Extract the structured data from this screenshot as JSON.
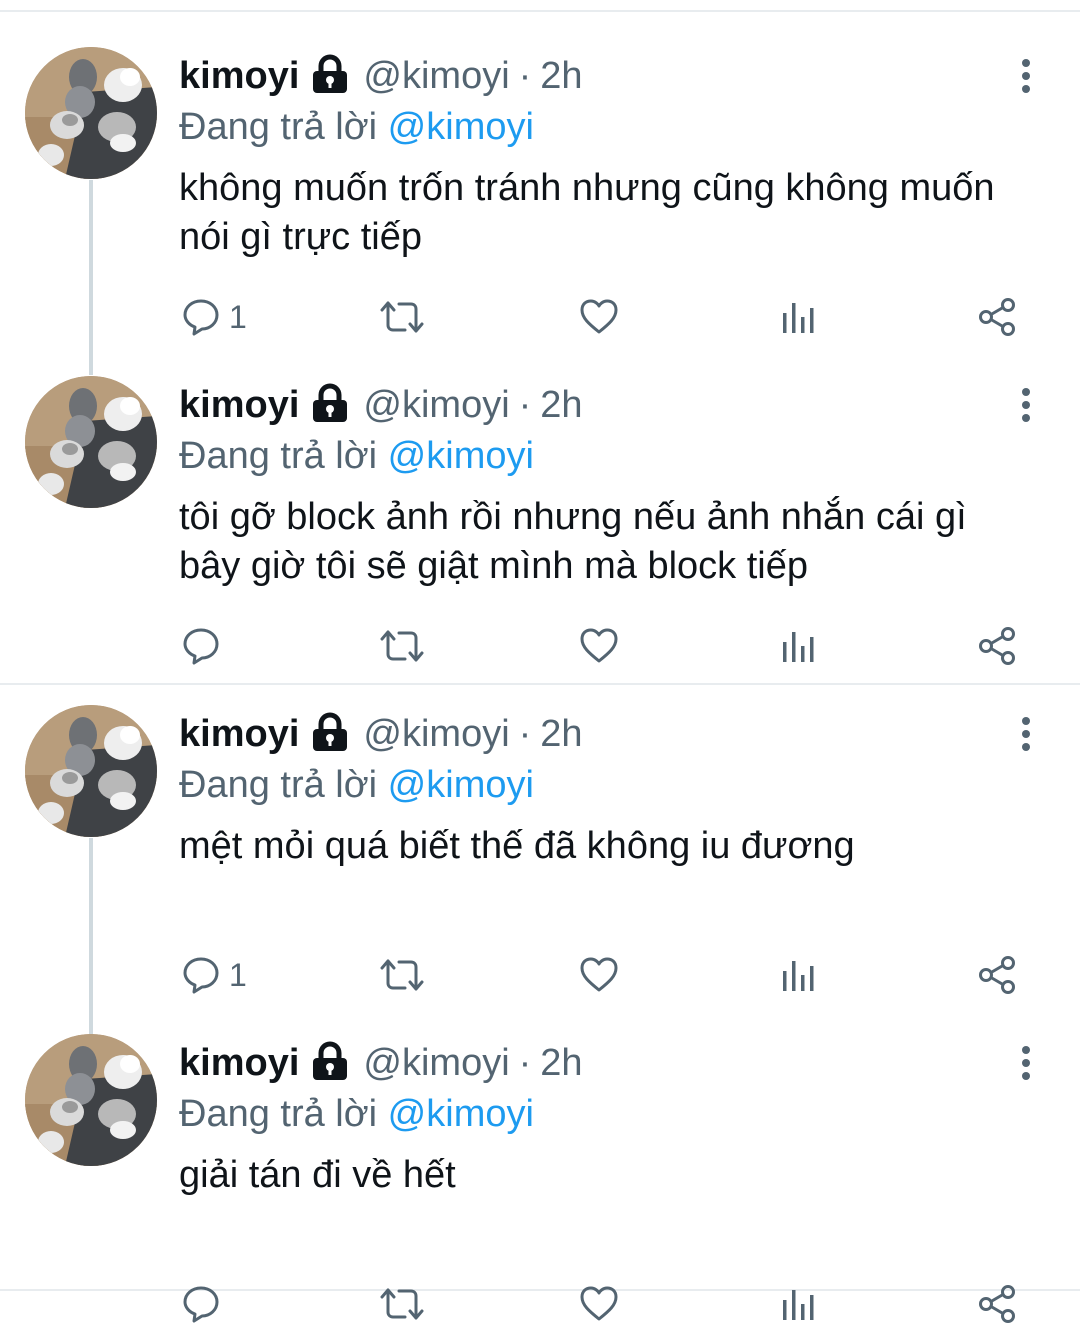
{
  "tweets": [
    {
      "name": "kimoyi",
      "handle": "@kimoyi",
      "dot": "·",
      "time": "2h",
      "reply_prefix": "Đang trả lời",
      "reply_mention": "@kimoyi",
      "text": "không muốn trốn tránh nhưng cũng không muốn nói gì trực tiếp",
      "reply_count": "1",
      "icons": [
        "lock-icon",
        "more-icon",
        "reply-icon",
        "retweet-icon",
        "like-icon",
        "analytics-icon",
        "share-icon"
      ]
    },
    {
      "name": "kimoyi",
      "handle": "@kimoyi",
      "dot": "·",
      "time": "2h",
      "reply_prefix": "Đang trả lời",
      "reply_mention": "@kimoyi",
      "text": "tôi gỡ block ảnh rồi nhưng nếu ảnh nhắn cái gì bây giờ tôi sẽ giật mình mà block tiếp",
      "reply_count": ""
    },
    {
      "name": "kimoyi",
      "handle": "@kimoyi",
      "dot": "·",
      "time": "2h",
      "reply_prefix": "Đang trả lời",
      "reply_mention": "@kimoyi",
      "text": "mệt mỏi quá biết thế đã không iu đương",
      "reply_count": "1"
    },
    {
      "name": "kimoyi",
      "handle": "@kimoyi",
      "dot": "·",
      "time": "2h",
      "reply_prefix": "Đang trả lời",
      "reply_mention": "@kimoyi",
      "text": "giải tán đi về hết",
      "reply_count": ""
    }
  ],
  "colors": {
    "text_primary": "#0f1419",
    "text_secondary": "#536471",
    "mention": "#1d9bf0",
    "thread_line": "#cfd9de",
    "divider": "#e8ecef"
  }
}
